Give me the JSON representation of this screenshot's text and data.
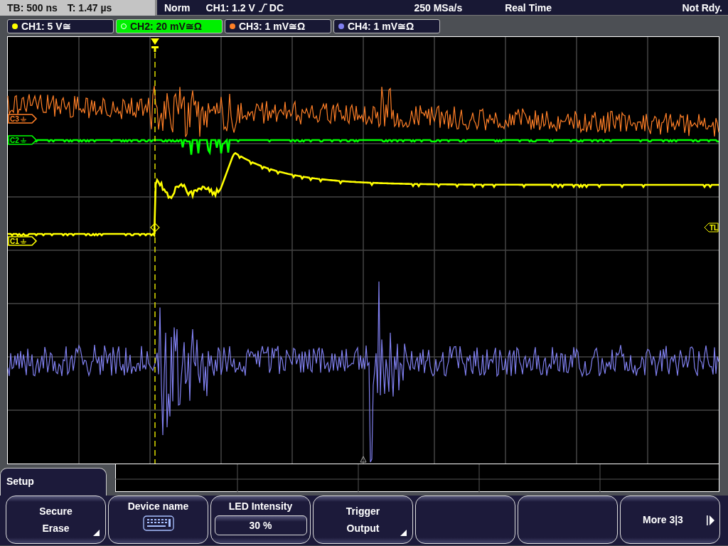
{
  "status_bar": {
    "timebase": "TB: 500 ns",
    "trigger_time": "T: 1.47 µs",
    "mode": "Norm",
    "trigger": "CH1: 1.2 V",
    "coupling": "DC",
    "sample_rate": "250 MSa/s",
    "acquisition": "Real Time",
    "state": "Not Rdy."
  },
  "channels": [
    {
      "label": "CH1: 5 V≅",
      "selected": false,
      "color": "#ffff00"
    },
    {
      "label": "CH2: 20 mV≅Ω",
      "selected": true,
      "color": "#00ff00"
    },
    {
      "label": "CH3: 1 mV≅Ω",
      "selected": false,
      "color": "#ff7f27"
    },
    {
      "label": "CH4: 1 mV≅Ω",
      "selected": false,
      "color": "#8080f0"
    }
  ],
  "markers": [
    {
      "label": "C3",
      "color": "#ff7f27"
    },
    {
      "label": "C2",
      "color": "#00ff00"
    },
    {
      "label": "C1",
      "color": "#ffff00"
    }
  ],
  "trigger_level_label": "TL",
  "menu": {
    "title": "Setup",
    "softkeys": [
      {
        "kind": "text",
        "lines": [
          "Secure",
          "Erase"
        ],
        "submenu": true
      },
      {
        "kind": "keyboard",
        "label": "Device name"
      },
      {
        "kind": "value",
        "label": "LED Intensity",
        "value": "30 %"
      },
      {
        "kind": "text",
        "lines": [
          "Trigger",
          "Output"
        ],
        "submenu": true
      },
      {
        "kind": "empty"
      },
      {
        "kind": "empty"
      },
      {
        "kind": "next",
        "label": "More 3|3"
      }
    ]
  }
}
